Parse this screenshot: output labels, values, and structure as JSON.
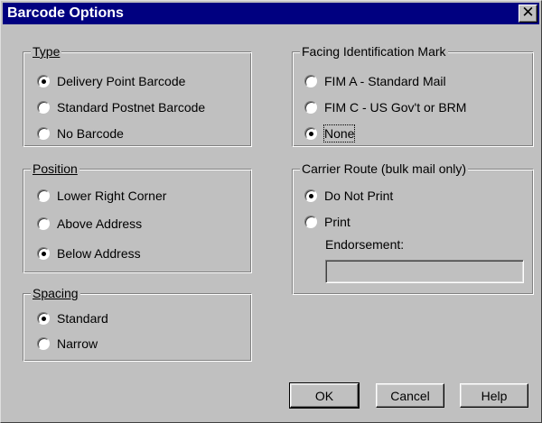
{
  "window": {
    "title": "Barcode Options",
    "close_glyph": "✕"
  },
  "type_group": {
    "label": "Type",
    "options": [
      {
        "label": "Delivery Point Barcode",
        "checked": true
      },
      {
        "label": "Standard Postnet Barcode",
        "checked": false
      },
      {
        "label": "No Barcode",
        "checked": false
      }
    ]
  },
  "position_group": {
    "label": "Position",
    "options": [
      {
        "label": "Lower Right Corner",
        "checked": false
      },
      {
        "label": "Above Address",
        "checked": false
      },
      {
        "label": "Below Address",
        "checked": true
      }
    ]
  },
  "spacing_group": {
    "label": "Spacing",
    "options": [
      {
        "label": "Standard",
        "checked": true
      },
      {
        "label": "Narrow",
        "checked": false
      }
    ]
  },
  "fim_group": {
    "label": "Facing Identification Mark",
    "options": [
      {
        "label": "FIM A - Standard Mail",
        "checked": false
      },
      {
        "label": "FIM C - US Gov't or BRM",
        "checked": false
      },
      {
        "label": "None",
        "checked": true
      }
    ]
  },
  "carrier_group": {
    "label": "Carrier Route  (bulk mail only)",
    "options": [
      {
        "label": "Do Not Print",
        "checked": true
      },
      {
        "label": "Print",
        "checked": false
      }
    ],
    "endorsement_label": "Endorsement:",
    "endorsement_value": ""
  },
  "buttons": {
    "ok": "OK",
    "cancel": "Cancel",
    "help": "Help"
  },
  "colors": {
    "face": "#c0c0c0",
    "titlebar": "#000080",
    "title_text": "#ffffff"
  },
  "icons": {
    "close": "close-icon"
  }
}
